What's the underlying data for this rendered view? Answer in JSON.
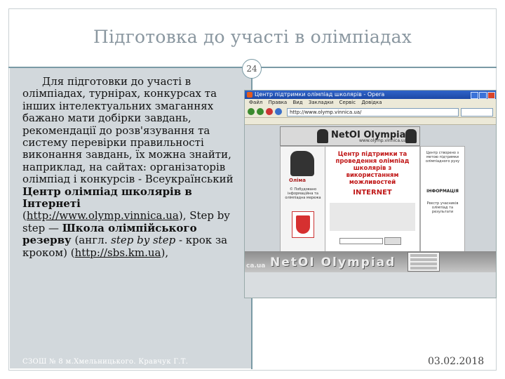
{
  "slide": {
    "title": "Підготовка до участі в олімпіадах",
    "page_number": "24",
    "footer_left": "СЗОШ № 8 м.Хмельницького. Кравчук Г.Т.",
    "footer_right": "03.02.2018"
  },
  "body": {
    "intro": "Для підготовки до участі в олімпіадах, турнірах, конкурсах та інших інтелектуальних змаганнях бажано мати добірки завдань, рекомендації до розв'язування та систему перевірки правильності виконання завдань, їх можна знайти, наприклад, на сайтах: організаторів олімпіад і конкурсів - Всеукраїнський ",
    "site1_name": "Центр олімпіад школярів в Інтернеті",
    "site1_url": "http://www.olymp.vinnica.ua",
    "after_site1": "), Step by step — ",
    "site2_name": "Школа олімпійського резерву",
    "site2_mid": " (англ. ",
    "site2_italic": "step by step",
    "site2_tail": " - крок за кроком) (",
    "site2_url": "http://sbs.km.ua",
    "end": "),"
  },
  "screenshot": {
    "window_title": "Центр підтримки олімпіад школярів - Opera",
    "menu_items": [
      "Файл",
      "Правка",
      "Вид",
      "Закладки",
      "Сервіс",
      "Довідка"
    ],
    "address": "http://www.olymp.vinnica.ua/",
    "banner_title": "NetOI Olympiad",
    "banner_url": "www.olymp.vinnica.ua",
    "logo_text": "Оліма",
    "left_small_text": "© Побудовано інформаційна та олімпіадна мережа",
    "main_title": "Центр підтримки та проведення олімпіад школярів з використанням можливостей",
    "main_internet": "INTERNET",
    "right_text_1": "Центр створено з метою підтримки олімпіадного руху",
    "right_heading": "ІНФОРМАЦІЯ",
    "right_text_2": "Реєстр учасників олімпіад та результати",
    "big_banner": "NetOI Olympiad",
    "big_banner_url": "ca.ua",
    "colors": {
      "titlebar": "#2f63c9",
      "accent_red": "#c01818"
    }
  }
}
